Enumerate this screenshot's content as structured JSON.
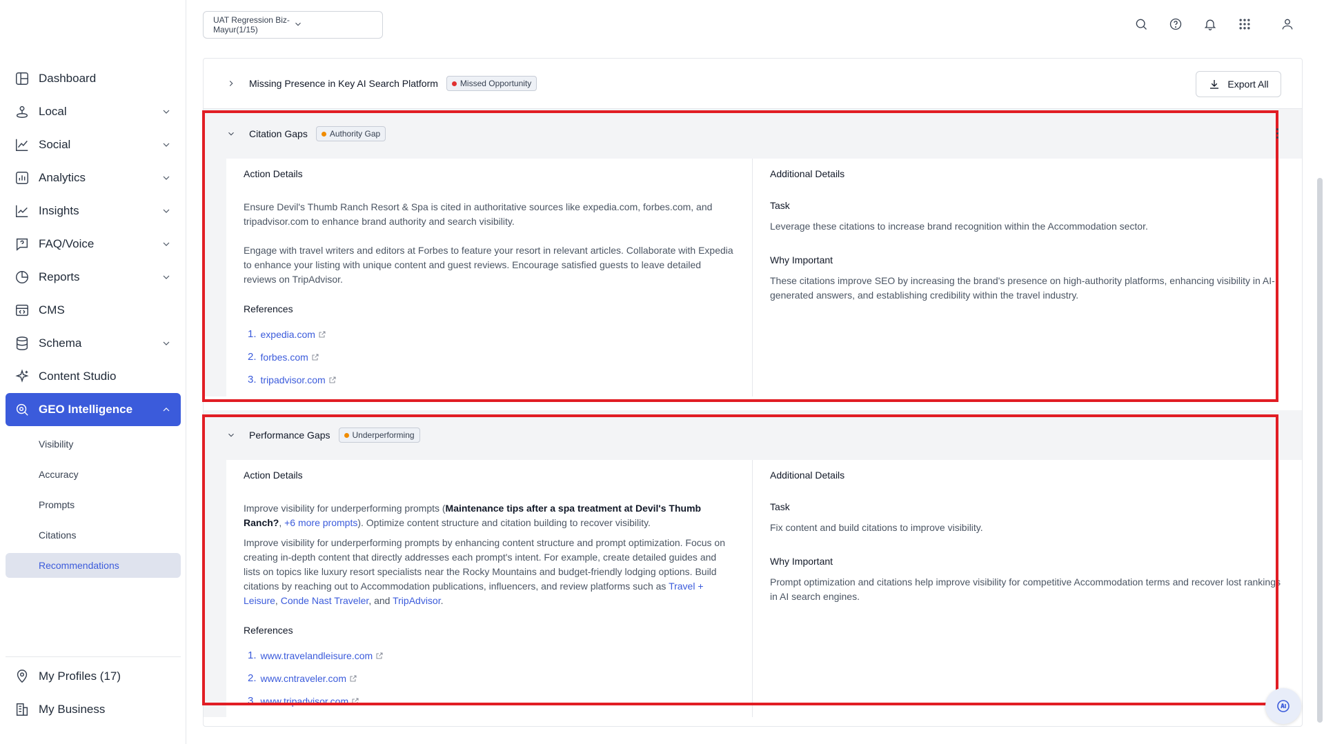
{
  "topbar": {
    "business_select": "UAT Regression Biz- Mayur(1/15)",
    "icons": [
      "search-icon",
      "help-icon",
      "bell-icon",
      "apps-grid-icon",
      "user-icon"
    ]
  },
  "sidebar": {
    "items": [
      {
        "label": "Dashboard",
        "icon": "dashboard-icon"
      },
      {
        "label": "Local",
        "icon": "local-icon"
      },
      {
        "label": "Social",
        "icon": "social-icon"
      },
      {
        "label": "Analytics",
        "icon": "analytics-icon"
      },
      {
        "label": "Insights",
        "icon": "insights-icon"
      },
      {
        "label": "FAQ/Voice",
        "icon": "faq-icon"
      },
      {
        "label": "Reports",
        "icon": "reports-icon"
      },
      {
        "label": "CMS",
        "icon": "cms-icon"
      },
      {
        "label": "Schema",
        "icon": "schema-icon"
      },
      {
        "label": "Content Studio",
        "icon": "sparkle-icon"
      },
      {
        "label": "GEO Intelligence",
        "icon": "geo-icon"
      }
    ],
    "sub_items": [
      "Visibility",
      "Accuracy",
      "Prompts",
      "Citations",
      "Recommendations"
    ],
    "bottom": [
      {
        "label": "My Profiles (17)",
        "icon": "location-pin-icon"
      },
      {
        "label": "My Business",
        "icon": "building-icon"
      }
    ]
  },
  "main": {
    "export_label": "Export All",
    "missing": {
      "title": "Missing Presence in Key AI Search Platform",
      "badge": "Missed Opportunity",
      "badge_color": "#e03131"
    },
    "citation": {
      "title": "Citation Gaps",
      "badge": "Authority Gap",
      "badge_color": "#f08c00",
      "action_title": "Action Details",
      "para1": "Ensure Devil's Thumb Ranch Resort & Spa is cited in authoritative sources like expedia.com, forbes.com, and tripadvisor.com to enhance brand authority and search visibility.",
      "para2": "Engage with travel writers and editors at Forbes to feature your resort in relevant articles. Collaborate with Expedia to enhance your listing with unique content and guest reviews. Encourage satisfied guests to leave detailed reviews on TripAdvisor.",
      "refs_title": "References",
      "refs": [
        "expedia.com",
        "forbes.com",
        "tripadvisor.com"
      ],
      "additional_title": "Additional Details",
      "task_title": "Task",
      "task_text": "Leverage these citations to increase brand recognition within the Accommodation sector.",
      "why_title": "Why Important",
      "why_text": "These citations improve SEO by increasing the brand's presence on high-authority platforms, enhancing visibility in AI-generated answers, and establishing credibility within the travel industry."
    },
    "performance": {
      "title": "Performance Gaps",
      "badge": "Underperforming",
      "badge_color": "#f08c00",
      "action_title": "Action Details",
      "p1_pre": "Improve visibility for underperforming prompts (",
      "p1_bold": "Maintenance tips after a spa treatment at Devil's Thumb Ranch?",
      "p1_sep": ", ",
      "p1_link": "+6 more prompts",
      "p1_post": "). Optimize content structure and citation building to recover visibility.",
      "p2_pre": "Improve visibility for underperforming prompts by enhancing content structure and prompt optimization. Focus on creating in-depth content that directly addresses each prompt's intent. For example, create detailed guides and lists on topics like luxury resort specialists near the Rocky Mountains and budget-friendly lodging options. Build citations by reaching out to Accommodation publications, influencers, and review platforms such as ",
      "p2_link1": "Travel + Leisure",
      "p2_c1": ", ",
      "p2_link2": "Conde Nast Traveler",
      "p2_c2": ", and ",
      "p2_link3": "TripAdvisor",
      "p2_end": ".",
      "refs_title": "References",
      "refs": [
        "www.travelandleisure.com",
        "www.cntraveler.com",
        "www.tripadvisor.com"
      ],
      "additional_title": "Additional Details",
      "task_title": "Task",
      "task_text": "Fix content and build citations to improve visibility.",
      "why_title": "Why Important",
      "why_text": "Prompt optimization and citations help improve visibility for competitive Accommodation terms and recover lost rankings in AI search engines."
    }
  },
  "colors": {
    "accent": "#3b5bdb",
    "highlight": "#e11d24"
  }
}
